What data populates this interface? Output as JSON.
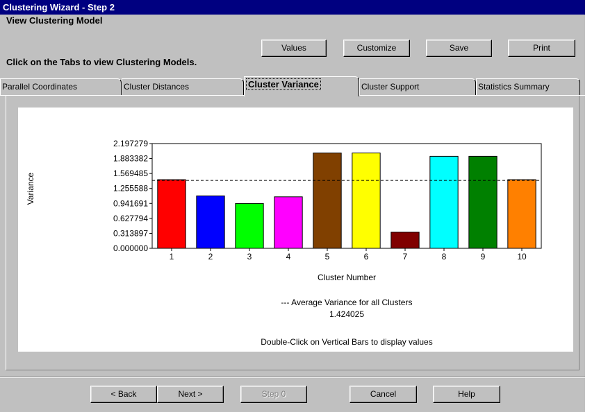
{
  "window": {
    "title": "Clustering Wizard - Step 2",
    "subtitle": "View Clustering Model",
    "instruction": "Click on the Tabs to view Clustering Models."
  },
  "toolbar": {
    "values_label": "Values",
    "customize_label": "Customize",
    "save_label": "Save",
    "print_label": "Print"
  },
  "tabs": [
    {
      "label": "Parallel Coordinates",
      "active": false
    },
    {
      "label": "Cluster Distances",
      "active": false
    },
    {
      "label": "Cluster Variance",
      "active": true
    },
    {
      "label": "Cluster Support",
      "active": false
    },
    {
      "label": "Statistics Summary",
      "active": false
    }
  ],
  "chart_data": {
    "type": "bar",
    "xlabel": "Cluster Number",
    "ylabel": "Variance",
    "categories": [
      "1",
      "2",
      "3",
      "4",
      "5",
      "6",
      "7",
      "8",
      "9",
      "10"
    ],
    "values": [
      1.44,
      1.1,
      0.94,
      1.08,
      2.0,
      2.0,
      0.34,
      1.93,
      1.93,
      1.44
    ],
    "colors": [
      "#ff0000",
      "#0000ff",
      "#00ff00",
      "#ff00ff",
      "#804000",
      "#ffff00",
      "#800000",
      "#00ffff",
      "#008000",
      "#ff8000"
    ],
    "yticks": [
      "2.197279",
      "1.883382",
      "1.569485",
      "1.255588",
      "0.941691",
      "0.627794",
      "0.313897",
      "0.000000"
    ],
    "ylim": [
      0,
      2.197279
    ],
    "average": 1.424025,
    "average_label": "--- Average Variance for all Clusters",
    "average_value_text": "1.424025",
    "hint": "Double-Click on Vertical Bars to display values"
  },
  "footer": {
    "back_label": "< Back",
    "next_label": "Next >",
    "step_label": "Step 0",
    "cancel_label": "Cancel",
    "help_label": "Help"
  }
}
